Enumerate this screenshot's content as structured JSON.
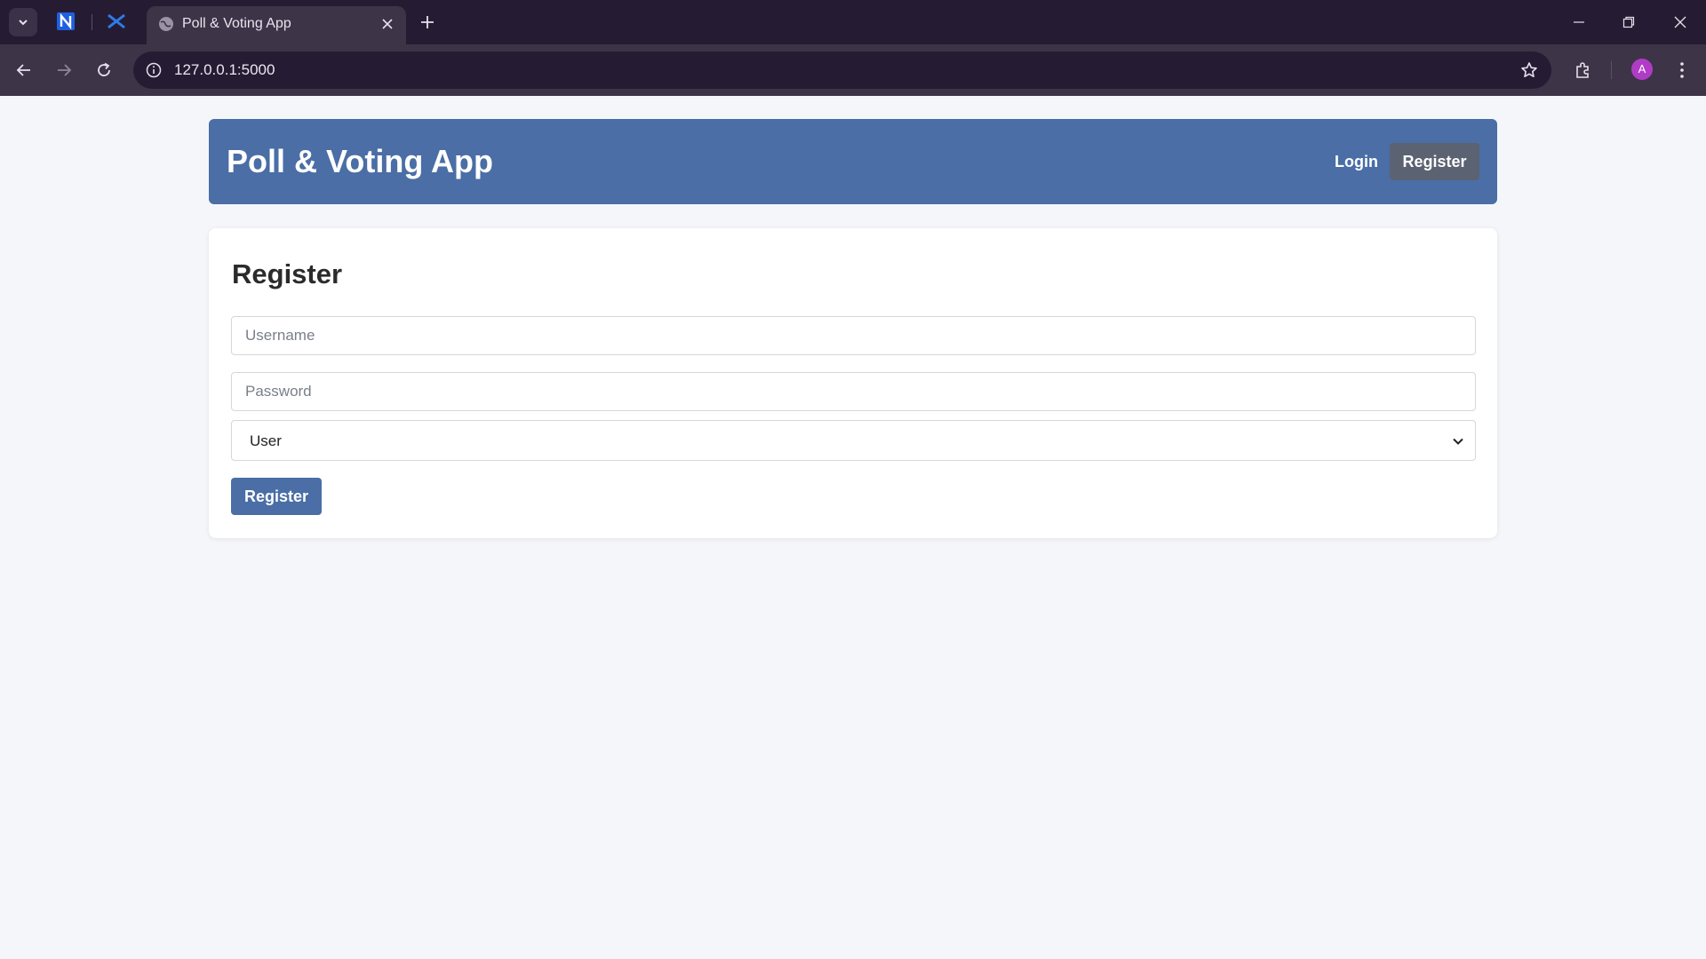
{
  "browser": {
    "tab_title": "Poll & Voting App",
    "url": "127.0.0.1:5000",
    "avatar_letter": "A"
  },
  "header": {
    "brand": "Poll & Voting App",
    "nav": {
      "login": "Login",
      "register": "Register"
    }
  },
  "form": {
    "title": "Register",
    "username_placeholder": "Username",
    "password_placeholder": "Password",
    "role_selected": "User",
    "submit_label": "Register"
  },
  "colors": {
    "header_bg": "#4a6ea5",
    "nav_register_bg": "#5b6272",
    "page_bg": "#f5f6fa",
    "browser_frame": "#251c33"
  },
  "icons": [
    "tab-search-icon",
    "pinned-app-icon",
    "globe-icon",
    "close-icon",
    "plus-icon",
    "minimize-icon",
    "restore-icon",
    "back-icon",
    "forward-icon",
    "reload-icon",
    "info-icon",
    "star-icon",
    "extensions-icon",
    "more-icon",
    "chevron-down-icon"
  ]
}
